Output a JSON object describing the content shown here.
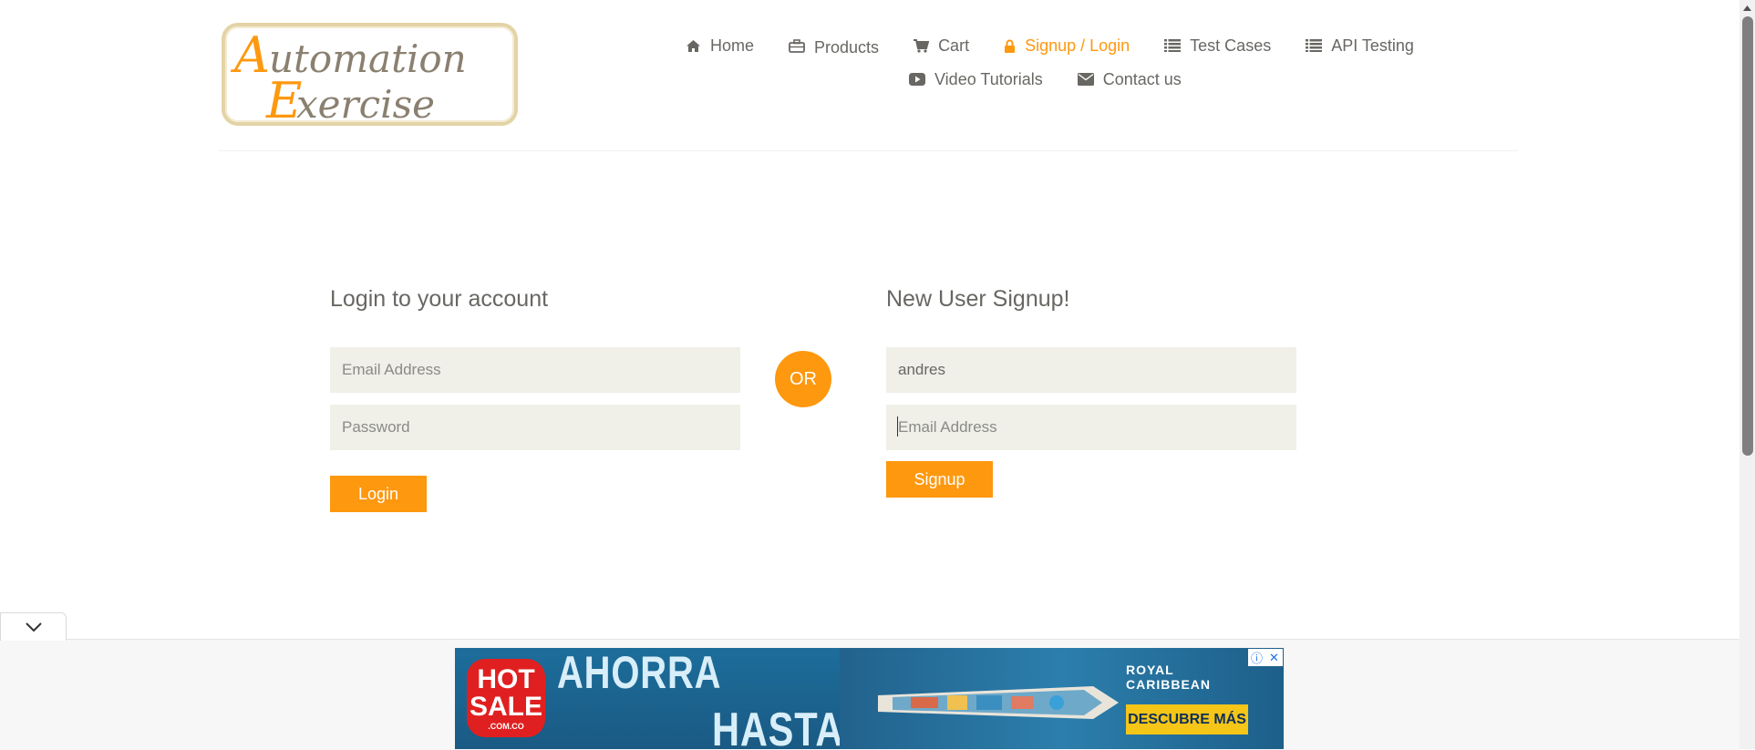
{
  "logo": {
    "line1": "Automation",
    "line2": "Exercise"
  },
  "nav": {
    "row1": [
      {
        "label": "Home",
        "icon": "home-icon"
      },
      {
        "label": "Products",
        "icon": "briefcase-icon"
      },
      {
        "label": "Cart",
        "icon": "cart-icon"
      },
      {
        "label": "Signup / Login",
        "icon": "lock-icon",
        "active": true
      },
      {
        "label": "Test Cases",
        "icon": "list-icon"
      },
      {
        "label": "API Testing",
        "icon": "list-icon"
      }
    ],
    "row2": [
      {
        "label": "Video Tutorials",
        "icon": "youtube-icon"
      },
      {
        "label": "Contact us",
        "icon": "envelope-icon"
      }
    ]
  },
  "login": {
    "title": "Login to your account",
    "email_placeholder": "Email Address",
    "password_placeholder": "Password",
    "button": "Login"
  },
  "or_label": "OR",
  "signup": {
    "title": "New User Signup!",
    "name_value": "andres",
    "email_placeholder": "Email Address",
    "button": "Signup"
  },
  "ad": {
    "badge_line1": "HOT",
    "badge_line2": "SALE",
    "badge_sub": ".COM.CO",
    "headline1": "AHORRA",
    "headline2": "HASTA",
    "brand_line1": "ROYAL",
    "brand_line2": "CARIBBEAN",
    "cta": "DESCUBRE MÁS"
  },
  "colors": {
    "accent": "#FE980F",
    "input_bg": "#F0F0E9",
    "text": "#696763"
  }
}
